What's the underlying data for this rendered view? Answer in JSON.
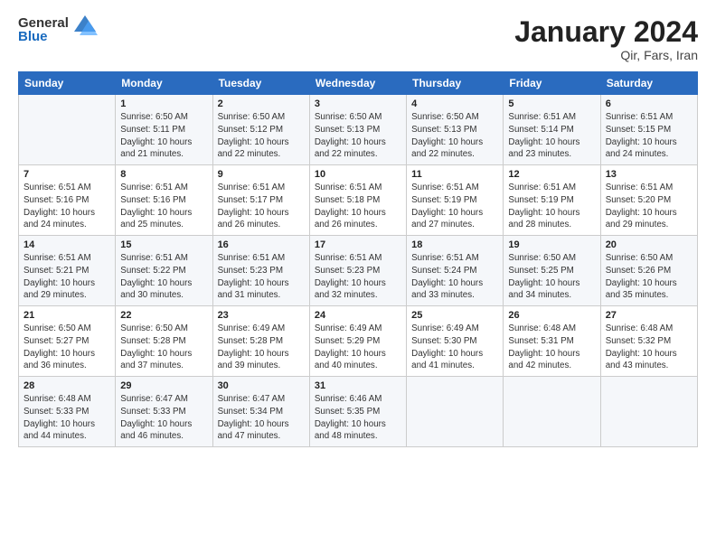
{
  "logo": {
    "general": "General",
    "blue": "Blue"
  },
  "title": "January 2024",
  "location": "Qir, Fars, Iran",
  "days_header": [
    "Sunday",
    "Monday",
    "Tuesday",
    "Wednesday",
    "Thursday",
    "Friday",
    "Saturday"
  ],
  "weeks": [
    [
      {
        "day": "",
        "info": ""
      },
      {
        "day": "1",
        "info": "Sunrise: 6:50 AM\nSunset: 5:11 PM\nDaylight: 10 hours\nand 21 minutes."
      },
      {
        "day": "2",
        "info": "Sunrise: 6:50 AM\nSunset: 5:12 PM\nDaylight: 10 hours\nand 22 minutes."
      },
      {
        "day": "3",
        "info": "Sunrise: 6:50 AM\nSunset: 5:13 PM\nDaylight: 10 hours\nand 22 minutes."
      },
      {
        "day": "4",
        "info": "Sunrise: 6:50 AM\nSunset: 5:13 PM\nDaylight: 10 hours\nand 22 minutes."
      },
      {
        "day": "5",
        "info": "Sunrise: 6:51 AM\nSunset: 5:14 PM\nDaylight: 10 hours\nand 23 minutes."
      },
      {
        "day": "6",
        "info": "Sunrise: 6:51 AM\nSunset: 5:15 PM\nDaylight: 10 hours\nand 24 minutes."
      }
    ],
    [
      {
        "day": "7",
        "info": "Sunrise: 6:51 AM\nSunset: 5:16 PM\nDaylight: 10 hours\nand 24 minutes."
      },
      {
        "day": "8",
        "info": "Sunrise: 6:51 AM\nSunset: 5:16 PM\nDaylight: 10 hours\nand 25 minutes."
      },
      {
        "day": "9",
        "info": "Sunrise: 6:51 AM\nSunset: 5:17 PM\nDaylight: 10 hours\nand 26 minutes."
      },
      {
        "day": "10",
        "info": "Sunrise: 6:51 AM\nSunset: 5:18 PM\nDaylight: 10 hours\nand 26 minutes."
      },
      {
        "day": "11",
        "info": "Sunrise: 6:51 AM\nSunset: 5:19 PM\nDaylight: 10 hours\nand 27 minutes."
      },
      {
        "day": "12",
        "info": "Sunrise: 6:51 AM\nSunset: 5:19 PM\nDaylight: 10 hours\nand 28 minutes."
      },
      {
        "day": "13",
        "info": "Sunrise: 6:51 AM\nSunset: 5:20 PM\nDaylight: 10 hours\nand 29 minutes."
      }
    ],
    [
      {
        "day": "14",
        "info": "Sunrise: 6:51 AM\nSunset: 5:21 PM\nDaylight: 10 hours\nand 29 minutes."
      },
      {
        "day": "15",
        "info": "Sunrise: 6:51 AM\nSunset: 5:22 PM\nDaylight: 10 hours\nand 30 minutes."
      },
      {
        "day": "16",
        "info": "Sunrise: 6:51 AM\nSunset: 5:23 PM\nDaylight: 10 hours\nand 31 minutes."
      },
      {
        "day": "17",
        "info": "Sunrise: 6:51 AM\nSunset: 5:23 PM\nDaylight: 10 hours\nand 32 minutes."
      },
      {
        "day": "18",
        "info": "Sunrise: 6:51 AM\nSunset: 5:24 PM\nDaylight: 10 hours\nand 33 minutes."
      },
      {
        "day": "19",
        "info": "Sunrise: 6:50 AM\nSunset: 5:25 PM\nDaylight: 10 hours\nand 34 minutes."
      },
      {
        "day": "20",
        "info": "Sunrise: 6:50 AM\nSunset: 5:26 PM\nDaylight: 10 hours\nand 35 minutes."
      }
    ],
    [
      {
        "day": "21",
        "info": "Sunrise: 6:50 AM\nSunset: 5:27 PM\nDaylight: 10 hours\nand 36 minutes."
      },
      {
        "day": "22",
        "info": "Sunrise: 6:50 AM\nSunset: 5:28 PM\nDaylight: 10 hours\nand 37 minutes."
      },
      {
        "day": "23",
        "info": "Sunrise: 6:49 AM\nSunset: 5:28 PM\nDaylight: 10 hours\nand 39 minutes."
      },
      {
        "day": "24",
        "info": "Sunrise: 6:49 AM\nSunset: 5:29 PM\nDaylight: 10 hours\nand 40 minutes."
      },
      {
        "day": "25",
        "info": "Sunrise: 6:49 AM\nSunset: 5:30 PM\nDaylight: 10 hours\nand 41 minutes."
      },
      {
        "day": "26",
        "info": "Sunrise: 6:48 AM\nSunset: 5:31 PM\nDaylight: 10 hours\nand 42 minutes."
      },
      {
        "day": "27",
        "info": "Sunrise: 6:48 AM\nSunset: 5:32 PM\nDaylight: 10 hours\nand 43 minutes."
      }
    ],
    [
      {
        "day": "28",
        "info": "Sunrise: 6:48 AM\nSunset: 5:33 PM\nDaylight: 10 hours\nand 44 minutes."
      },
      {
        "day": "29",
        "info": "Sunrise: 6:47 AM\nSunset: 5:33 PM\nDaylight: 10 hours\nand 46 minutes."
      },
      {
        "day": "30",
        "info": "Sunrise: 6:47 AM\nSunset: 5:34 PM\nDaylight: 10 hours\nand 47 minutes."
      },
      {
        "day": "31",
        "info": "Sunrise: 6:46 AM\nSunset: 5:35 PM\nDaylight: 10 hours\nand 48 minutes."
      },
      {
        "day": "",
        "info": ""
      },
      {
        "day": "",
        "info": ""
      },
      {
        "day": "",
        "info": ""
      }
    ]
  ]
}
